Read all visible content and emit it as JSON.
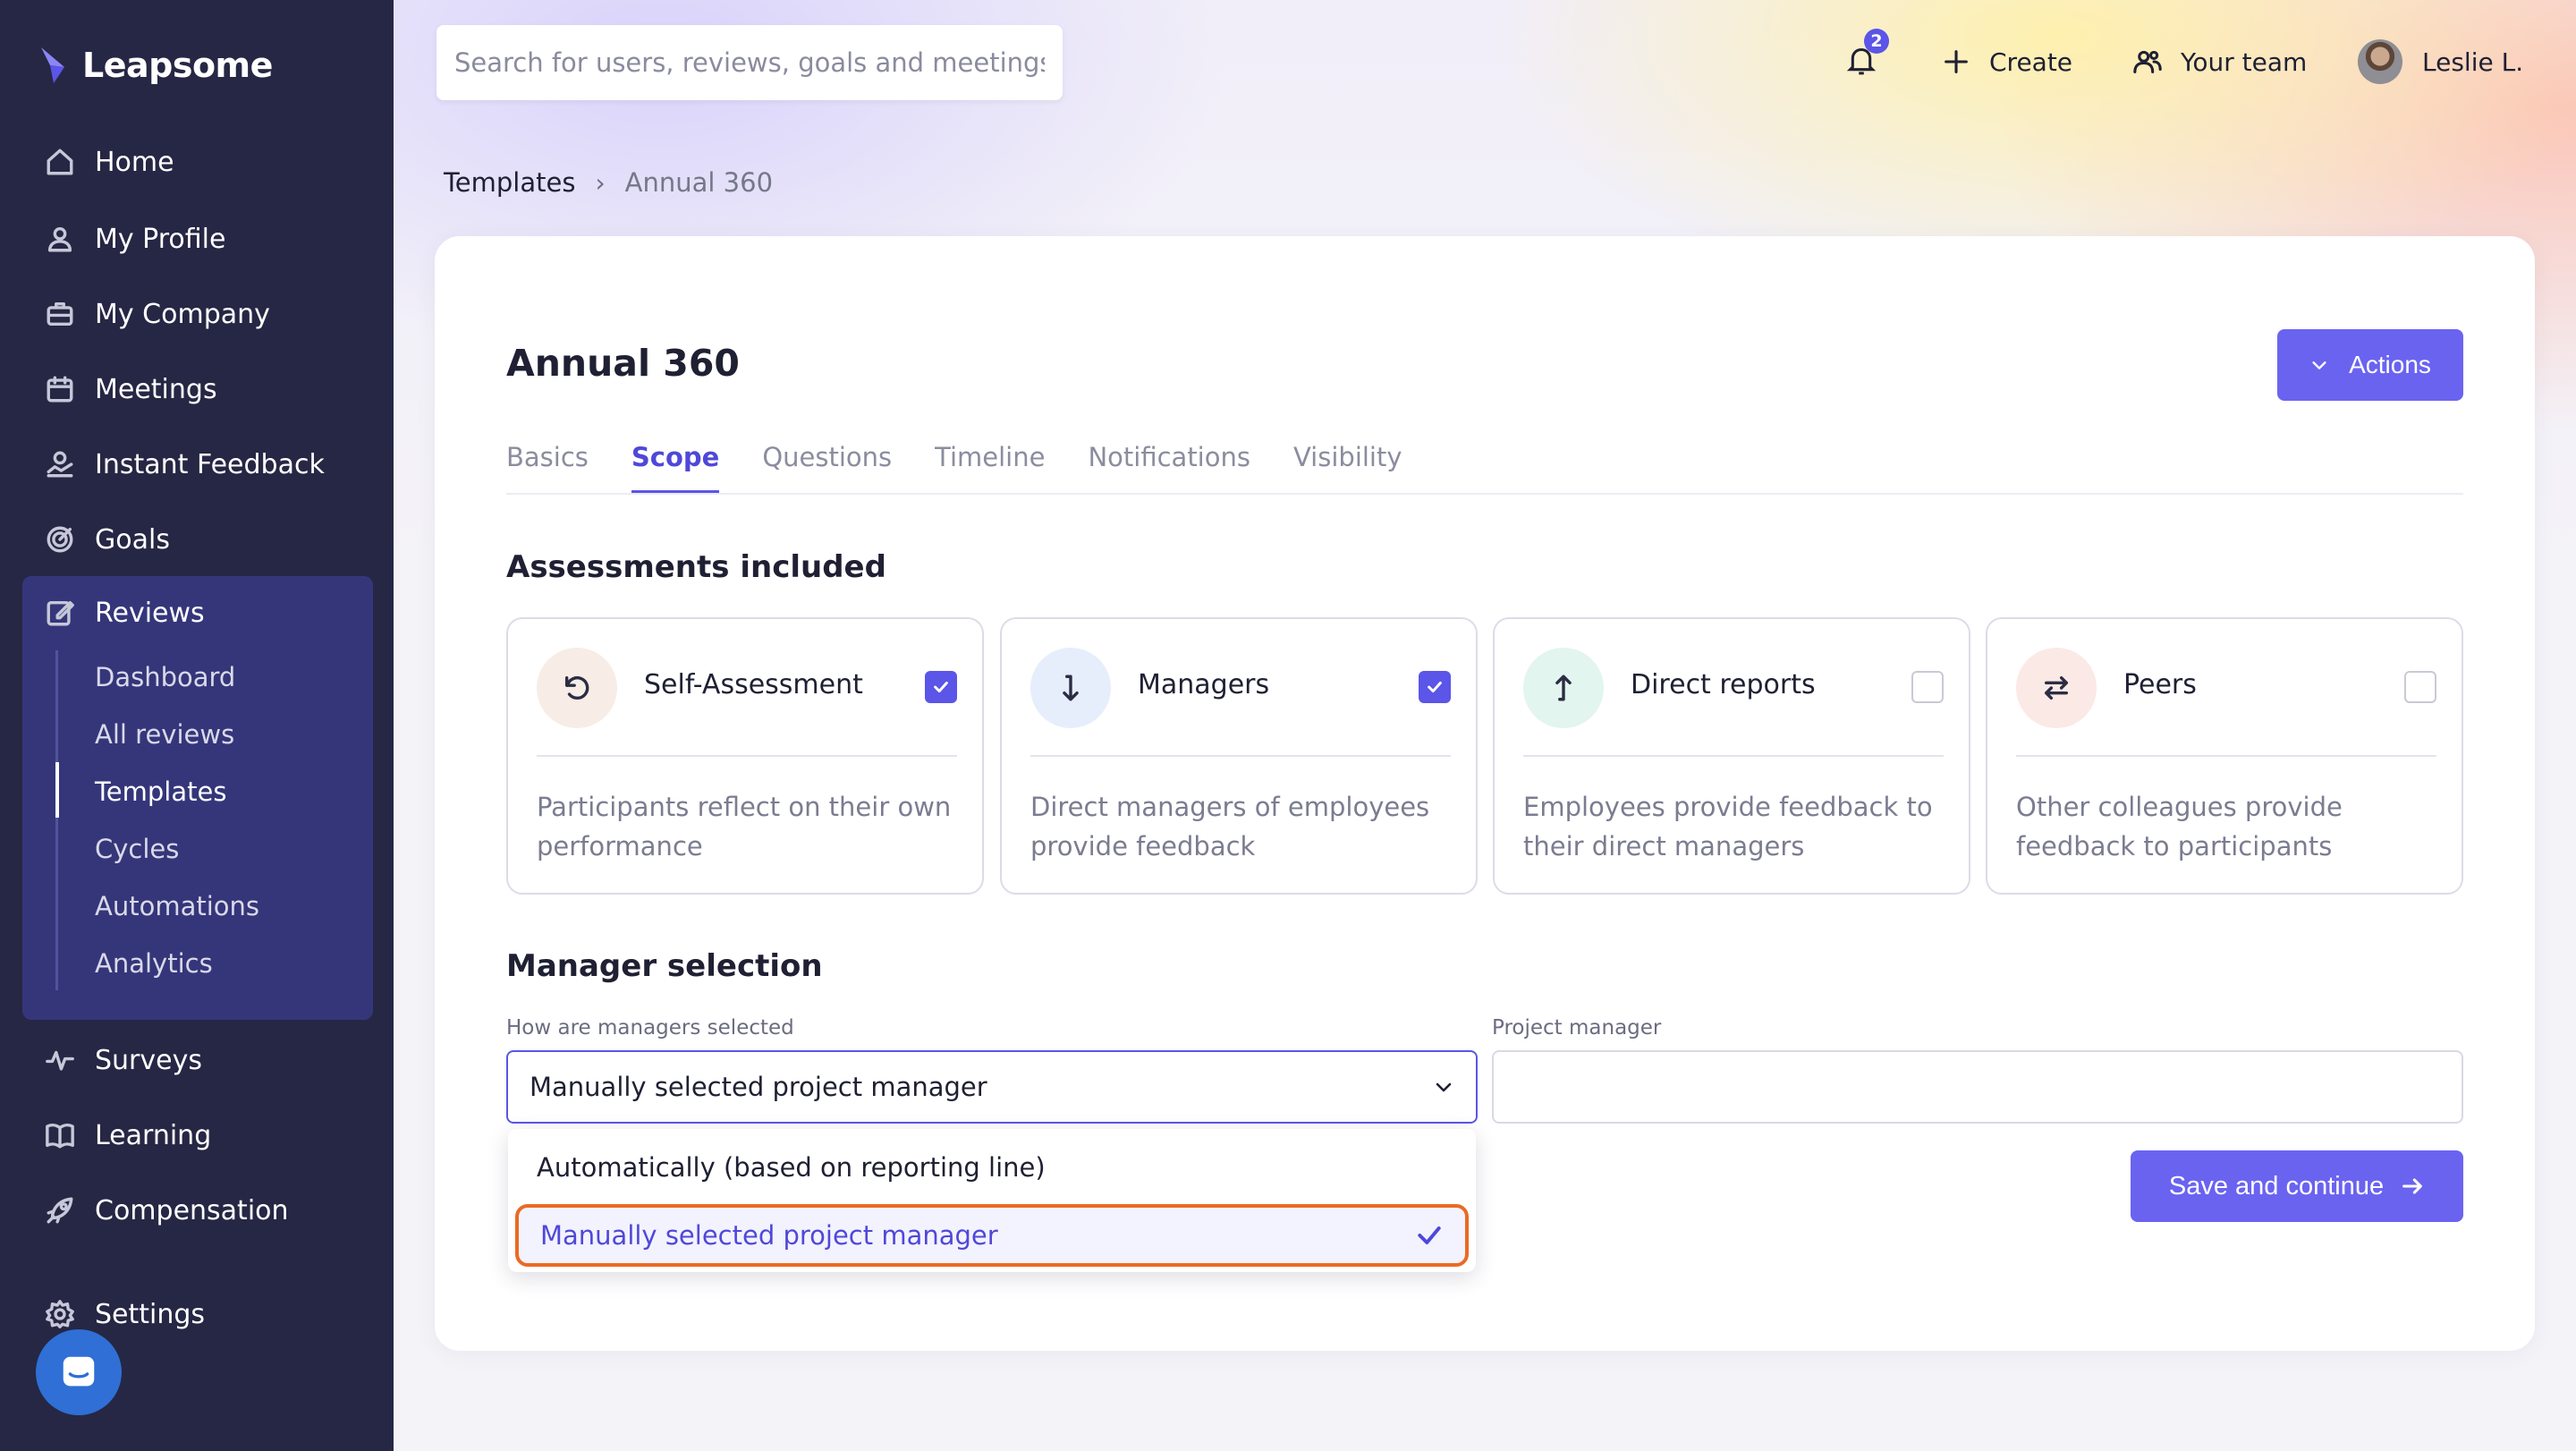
{
  "app": {
    "name": "Leapsome"
  },
  "sidebar": {
    "items": [
      {
        "label": "Home",
        "icon": "home-icon"
      },
      {
        "label": "My Profile",
        "icon": "user-icon"
      },
      {
        "label": "My Company",
        "icon": "briefcase-icon"
      },
      {
        "label": "Meetings",
        "icon": "calendar-icon"
      },
      {
        "label": "Instant Feedback",
        "icon": "feedback-icon"
      },
      {
        "label": "Goals",
        "icon": "target-icon"
      },
      {
        "label": "Reviews",
        "icon": "edit-icon"
      },
      {
        "label": "Surveys",
        "icon": "pulse-icon"
      },
      {
        "label": "Learning",
        "icon": "book-icon"
      },
      {
        "label": "Compensation",
        "icon": "rocket-icon"
      },
      {
        "label": "Settings",
        "icon": "gear-icon"
      }
    ],
    "reviews_sub": [
      "Dashboard",
      "All reviews",
      "Templates",
      "Cycles",
      "Automations",
      "Analytics"
    ],
    "active_sub": "Templates"
  },
  "topbar": {
    "search_placeholder": "Search for users, reviews, goals and meetings",
    "notifications_count": "2",
    "create_label": "Create",
    "team_label": "Your team",
    "user_name": "Leslie L."
  },
  "breadcrumb": {
    "parent": "Templates",
    "current": "Annual 360"
  },
  "page": {
    "title": "Annual 360",
    "actions_label": "Actions",
    "tabs": [
      "Basics",
      "Scope",
      "Questions",
      "Timeline",
      "Notifications",
      "Visibility"
    ],
    "active_tab": "Scope"
  },
  "assessments": {
    "title": "Assessments included",
    "cards": [
      {
        "name": "Self-Assessment",
        "desc": "Participants reflect on their own performance",
        "checked": true,
        "icon": "rotate-ccw-icon",
        "color": "#f7ede6"
      },
      {
        "name": "Managers",
        "desc": "Direct managers of employees provide feedback",
        "checked": true,
        "icon": "arrow-down-icon",
        "color": "#e6eefb"
      },
      {
        "name": "Direct reports",
        "desc": "Employees provide feedback to their direct managers",
        "checked": false,
        "icon": "arrow-up-icon",
        "color": "#e2f5ee"
      },
      {
        "name": "Peers",
        "desc": "Other colleagues provide feedback to participants",
        "checked": false,
        "icon": "swap-icon",
        "color": "#fbe9e5"
      }
    ]
  },
  "manager_selection": {
    "title": "Manager selection",
    "how_label": "How are managers selected",
    "selected_value": "Manually selected project manager",
    "project_manager_label": "Project manager",
    "project_manager_value": "",
    "options": [
      "Automatically (based on reporting line)",
      "Manually selected project manager"
    ]
  },
  "save_label": "Save and continue",
  "colors": {
    "sidebar": "#262744",
    "accent": "#5b55e8",
    "highlight": "#ea6a24"
  }
}
